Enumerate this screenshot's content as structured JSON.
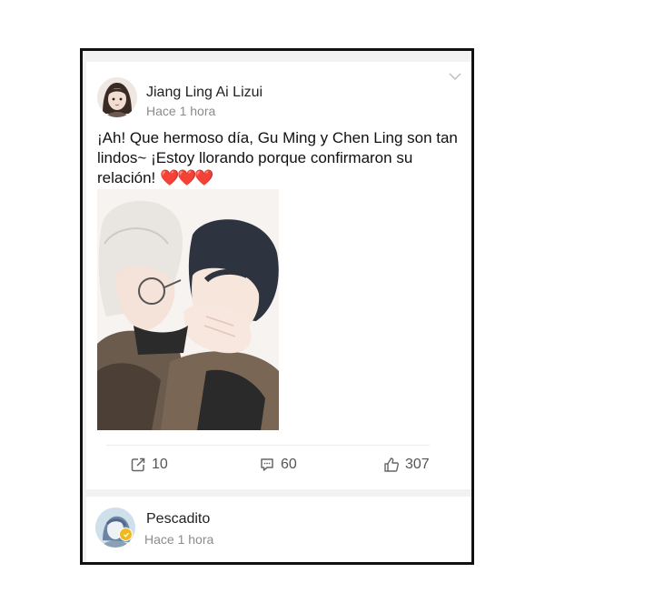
{
  "posts": [
    {
      "author": "Jiang Ling Ai Lizui",
      "time": "Hace 1 hora",
      "text": "¡Ah! Que hermoso día, Gu Ming y Chen  Ling son tan lindos~ ¡Estoy llorando porque confirmaron su relación!",
      "text_emoji": "❤️❤️❤️",
      "actions": {
        "share_count": "10",
        "comment_count": "60",
        "like_count": "307"
      }
    },
    {
      "author": "Pescadito",
      "time": "Hace 1 hora"
    }
  ],
  "icons": {
    "share": "share-icon",
    "comment": "comment-icon",
    "like": "thumbs-up-icon",
    "menu": "chevron-down-icon",
    "verified": "verified-badge-icon"
  },
  "colors": {
    "heart": "#e0263a",
    "badge": "#f2b91c",
    "muted_text": "#8b8b8b"
  }
}
